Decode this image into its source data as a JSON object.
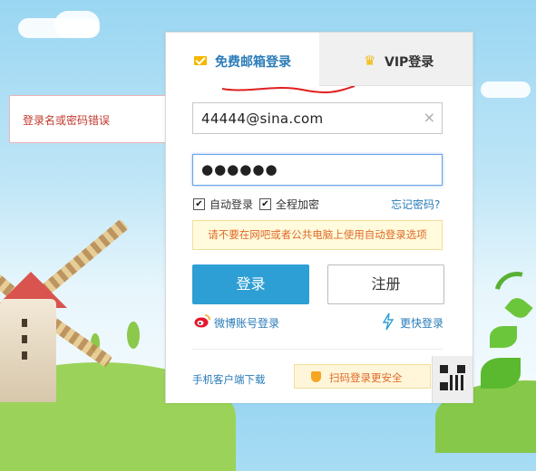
{
  "tabs": {
    "free_mail_login": "免费邮箱登录",
    "vip_login": "VIP登录"
  },
  "error_tooltip": "登录名或密码错误",
  "form": {
    "username_value": "44444@sina.com",
    "password_value": "●●●●●●",
    "clear_symbol": "×"
  },
  "options": {
    "auto_login": "自动登录",
    "full_encrypt": "全程加密",
    "forgot_password": "忘记密码?",
    "auto_login_checked": true,
    "full_encrypt_checked": true,
    "check_mark": "✔"
  },
  "warning_text": "请不要在网吧或者公共电脑上使用自动登录选项",
  "buttons": {
    "login": "登录",
    "register": "注册"
  },
  "alt_login": {
    "weibo": "微博账号登录",
    "faster": "更快登录"
  },
  "footer": {
    "mobile_client": "手机客户端下载",
    "scan_login": "扫码登录更安全"
  },
  "icons": {
    "mail": "mail-icon",
    "crown": "crown-icon",
    "weibo": "weibo-icon",
    "bolt": "lightning-icon",
    "shield": "shield-icon",
    "qr": "qr-code-icon"
  },
  "colors": {
    "accent_blue": "#2e9fd4",
    "tab_active_text": "#2a7bb8",
    "warning_text": "#e06b2a",
    "error_text": "#c0392b",
    "gold": "#f5b700"
  }
}
